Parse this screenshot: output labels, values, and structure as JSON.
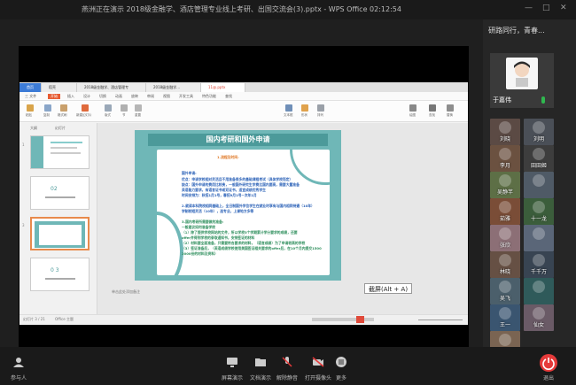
{
  "window": {
    "title": "燕洲正在演示 2018级金融学、酒店管理专业线上考研、出国交流会(3).pptx - WPS Office 02:12:54",
    "controls": [
      "—",
      "□",
      "✕"
    ]
  },
  "wps": {
    "doc_tabs": [
      {
        "label": "首页"
      },
      {
        "label": "稻壳"
      },
      {
        "label": "2018级金融学、酒店管理专"
      },
      {
        "label": "2018级金融学..."
      },
      {
        "label": "11@.pptx"
      }
    ],
    "ribbon_tabs": [
      "三 文件",
      "开始",
      "插入",
      "设计",
      "切换",
      "动画",
      "放映",
      "审阅",
      "视图",
      "开发工具",
      "特色功能",
      "查找"
    ],
    "ribbon_buttons": [
      "粘贴",
      "复制",
      "格式刷",
      "新建幻灯片",
      "版式",
      "节",
      "重置",
      "文本框",
      "形状",
      "排列",
      "绘图",
      "查找",
      "替换"
    ],
    "thumb_tabs": [
      "大纲",
      "幻灯片"
    ],
    "thumbnails": [
      {
        "num": "1",
        "label": ""
      },
      {
        "num": "",
        "label": "02"
      },
      {
        "num": "3",
        "label": ""
      },
      {
        "num": "",
        "label": "0 3"
      }
    ],
    "notes_placeholder": "单击此处添加备注",
    "status_left": "幻灯片 3 / 21",
    "status_theme": "Office 主题"
  },
  "slide": {
    "title": "国内考研和国外申请",
    "lines": [
      {
        "text": "1.流程及时间:",
        "cls": "c-orange"
      },
      {
        "text": "国外申请:",
        "cls": "c-blue"
      },
      {
        "text": "优点：申请学校相对灵活且不用准备很多的基础课程考试（具体学校而定）",
        "cls": "c-blue"
      },
      {
        "text": "缺点：国外申请的费用比较贵，一般国外研究生学费比国内要高，需要大量准备",
        "cls": "c-blue"
      },
      {
        "text": "英语能力要求，有语言证书或双证书，适宜成绩优秀学生",
        "cls": "c-blue"
      },
      {
        "text": "时间安排为：秋招1月1号，春招9月1号~次年1月",
        "cls": "c-blue"
      },
      {
        "text": "2.就读本科院校相同基础上，全日制国外学位学生在就业时享有与国内相同待遇（10年）",
        "cls": "c-blue"
      },
      {
        "text": "学制较短灵活（10年），选专业，上课地方多等",
        "cls": "c-blue"
      },
      {
        "text": "3.国内考研所需要做的准备:",
        "cls": "c-green"
      },
      {
        "text": "一般建议如何准备学校",
        "cls": "c-green"
      },
      {
        "text": "（1）除了提供学校网站的文件，所以学校3个学期累计学分要求的成绩，还要",
        "cls": "c-green"
      },
      {
        "text": "offer并得到学校的录取通知书，安排签证的材料",
        "cls": "c-green"
      },
      {
        "text": "（2）材料要全面准备，只需要符合要求的材料，（语言成绩）为了申请较高的学校",
        "cls": "c-green"
      },
      {
        "text": "（3）签证准备后，（英语成绩学校使用美国签证相关要求的offer后，在10个月内提交1500",
        "cls": "c-green"
      },
      {
        "text": "2000份的材料及资料）",
        "cls": "c-green"
      }
    ]
  },
  "tooltip": "截屏(Alt + A)",
  "panel": {
    "header": "研路同行，青春...",
    "host": {
      "name": "于嘉伟"
    },
    "participants": [
      {
        "name": "刘晓",
        "bg": "#5b4a44"
      },
      {
        "name": "刘明",
        "bg": "#4a4f57"
      },
      {
        "name": "李月",
        "bg": "#6b5140"
      },
      {
        "name": "田田姬",
        "bg": "#3d3d3d"
      },
      {
        "name": "吴静芊",
        "bg": "#5d6f46"
      },
      {
        "name": "",
        "bg": "#4f5a66"
      },
      {
        "name": "茹雅",
        "bg": "#7a4d37"
      },
      {
        "name": "十一龙",
        "bg": "#3b5d3b"
      },
      {
        "name": "张欣",
        "bg": "#8c6f76"
      },
      {
        "name": "",
        "bg": "#5a6678"
      },
      {
        "name": "林晓",
        "bg": "#665044"
      },
      {
        "name": "千千万",
        "bg": "#384452"
      },
      {
        "name": "吴飞",
        "bg": "#4b5f6b"
      },
      {
        "name": "",
        "bg": "#2f5a5a"
      },
      {
        "name": "王一",
        "bg": "#3a5570"
      },
      {
        "name": "仙女",
        "bg": "#6a5a66"
      },
      {
        "name": "",
        "bg": "#7a6452"
      }
    ]
  },
  "bottombar": {
    "members_label": "参与人",
    "buttons": [
      "屏幕演示",
      "文档演示",
      "解除静音",
      "打开摄像头",
      "更多"
    ],
    "leave_label": "退出"
  }
}
